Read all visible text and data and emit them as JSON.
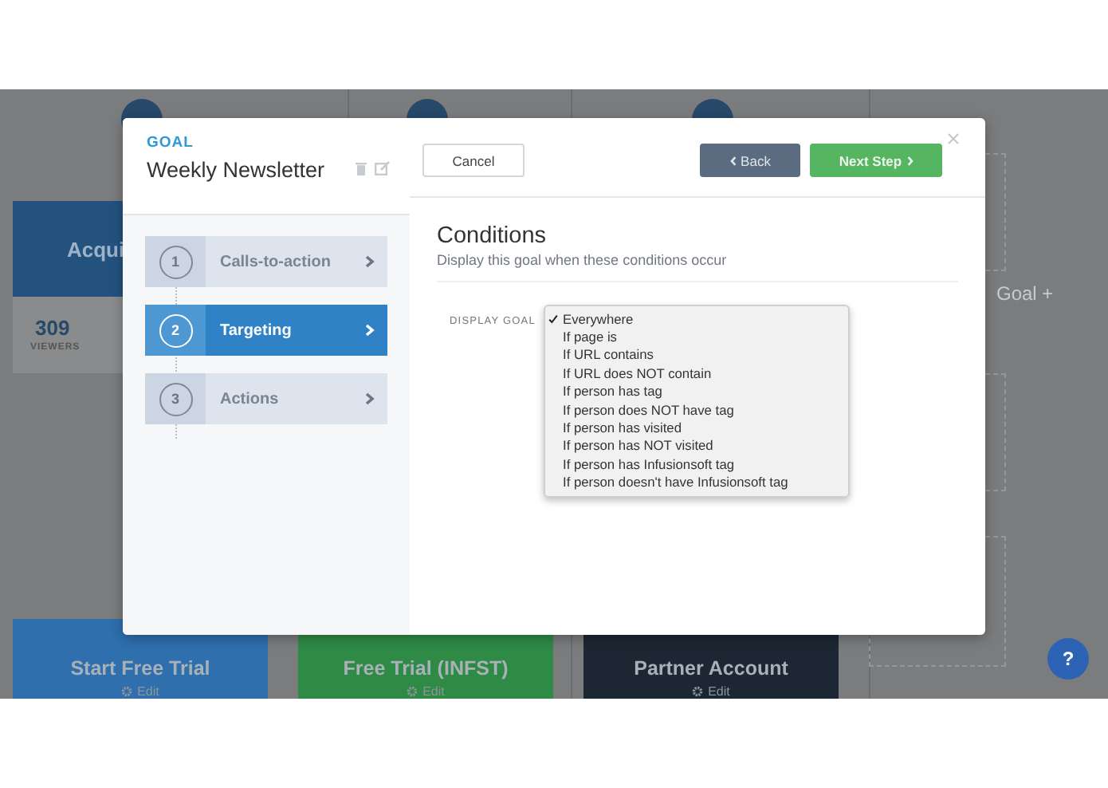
{
  "canvas": {
    "stats_card": {
      "title": "Acqui",
      "value": "309",
      "label": "VIEWERS"
    },
    "goal_cards": [
      {
        "title": "Start Free Trial",
        "edit": "Edit",
        "color": "#2f6fae"
      },
      {
        "title": "Free Trial (INFST)",
        "edit": "Edit",
        "color": "#2f8a46"
      },
      {
        "title": "Partner Account",
        "edit": "Edit",
        "color": "#1c2733"
      }
    ],
    "add_goal": "Goal +",
    "help_button": {
      "label": "?"
    }
  },
  "modal": {
    "eyebrow": "GOAL",
    "title": "Weekly Newsletter",
    "steps": [
      {
        "number": "1",
        "label": "Calls-to-action",
        "selected": false
      },
      {
        "number": "2",
        "label": "Targeting",
        "selected": true
      },
      {
        "number": "3",
        "label": "Actions",
        "selected": false
      }
    ],
    "buttons": {
      "cancel": "Cancel",
      "back": "Back",
      "next": "Next Step"
    },
    "heading": "Conditions",
    "subheading": "Display this goal when these conditions occur",
    "field_label": "DISPLAY GOAL",
    "options": [
      {
        "label": "Everywhere",
        "selected": true
      },
      {
        "label": "If page is",
        "selected": false
      },
      {
        "label": "If URL contains",
        "selected": false
      },
      {
        "label": "If URL does NOT contain",
        "selected": false
      },
      {
        "label": "If person has tag",
        "selected": false
      },
      {
        "label": "If person does NOT have tag",
        "selected": false
      },
      {
        "label": "If person has visited",
        "selected": false
      },
      {
        "label": "If person has NOT visited",
        "selected": false
      },
      {
        "label": "If person has Infusionsoft tag",
        "selected": false
      },
      {
        "label": "If person doesn't have Infusionsoft tag",
        "selected": false
      }
    ]
  }
}
